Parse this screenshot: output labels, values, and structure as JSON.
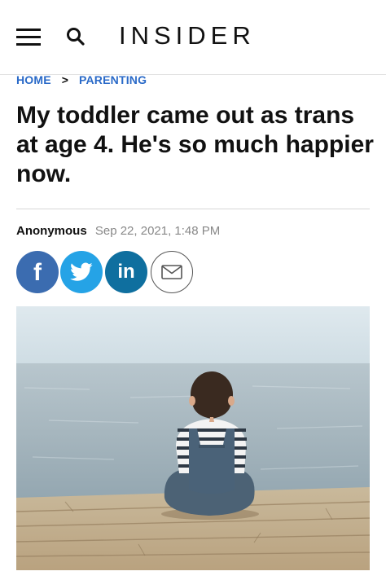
{
  "header": {
    "brand": "INSIDER",
    "menu_icon": "hamburger-menu-icon",
    "search_icon": "search-icon"
  },
  "breadcrumb": {
    "home": "HOME",
    "separator": ">",
    "section": "PARENTING"
  },
  "article": {
    "title": "My toddler came out as trans at age 4. He's so much happier now.",
    "author": "Anonymous",
    "date": "Sep 22, 2021, 1:48 PM"
  },
  "share": {
    "facebook_glyph": "f",
    "linkedin_glyph": "in",
    "icons": [
      "facebook-icon",
      "twitter-icon",
      "linkedin-icon",
      "email-icon"
    ]
  },
  "colors": {
    "link": "#2a6ac8",
    "facebook": "#3b6cb0",
    "twitter": "#25a3e6",
    "linkedin": "#0f6f9f"
  }
}
